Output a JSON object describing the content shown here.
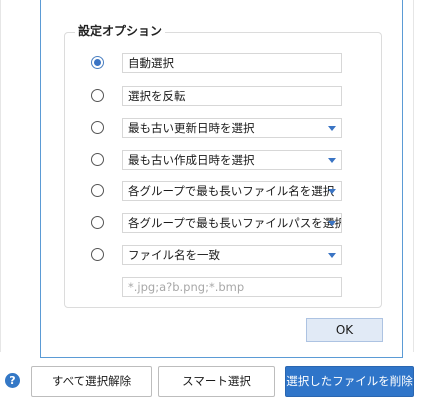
{
  "dialog": {
    "group_title": "設定オプション",
    "options": [
      {
        "label": "自動選択",
        "selected": true,
        "dropdown": false
      },
      {
        "label": "選択を反転",
        "selected": false,
        "dropdown": false
      },
      {
        "label": "最も古い更新日時を選択",
        "selected": false,
        "dropdown": true
      },
      {
        "label": "最も古い作成日時を選択",
        "selected": false,
        "dropdown": true
      },
      {
        "label": "各グループで最も長いファイル名を選択",
        "selected": false,
        "dropdown": true
      },
      {
        "label": "各グループで最も長いファイルパスを選択",
        "selected": false,
        "dropdown": true
      },
      {
        "label": "ファイル名を一致",
        "selected": false,
        "dropdown": true
      }
    ],
    "pattern_input": {
      "value": "",
      "placeholder": "*.jpg;a?b.png;*.bmp"
    },
    "ok_label": "OK"
  },
  "footer": {
    "help_icon": "question-circle-icon",
    "help_glyph": "?",
    "deselect_all_label": "すべて選択解除",
    "smart_select_label": "スマート選択",
    "delete_selected_label": "選択したファイルを削除"
  },
  "colors": {
    "accent": "#2f75c9",
    "popup_border": "#5b9bd5",
    "ok_button_bg": "#e1eaf6"
  }
}
